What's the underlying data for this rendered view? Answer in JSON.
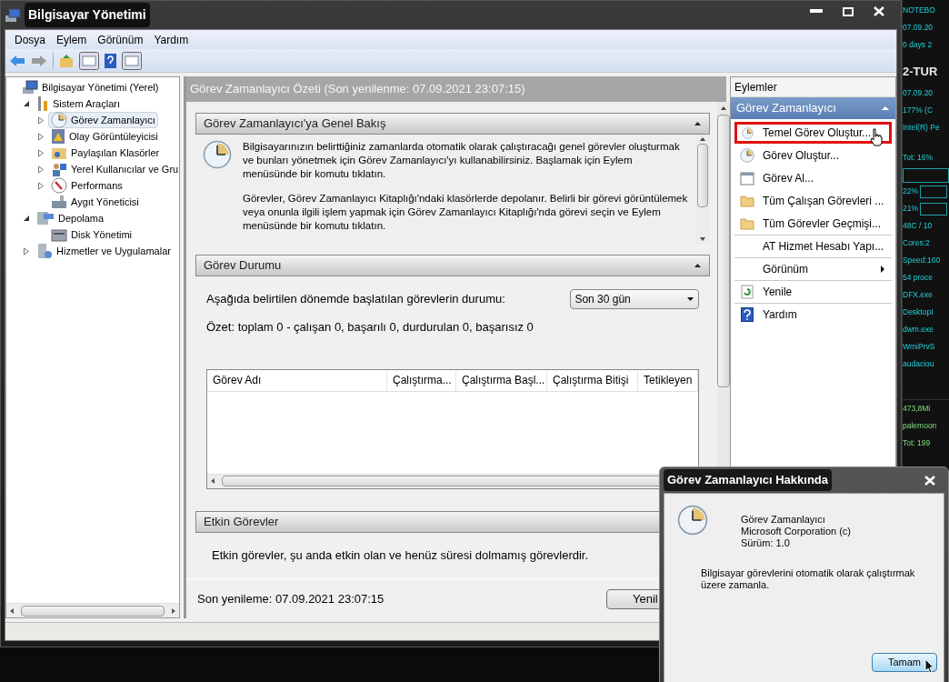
{
  "window": {
    "title": "Bilgisayar Yönetimi"
  },
  "menu": [
    "Dosya",
    "Eylem",
    "Görünüm",
    "Yardım"
  ],
  "tree": [
    {
      "label": "Bilgisayar Yönetimi (Yerel)",
      "kind": "computer",
      "selected": false,
      "children": [
        {
          "label": "Sistem Araçları",
          "kind": "tools",
          "expanded": true,
          "selected": false,
          "children": [
            {
              "label": "Görev Zamanlayıcı",
              "kind": "clock",
              "expanded": false,
              "selected": true
            },
            {
              "label": "Olay Görüntüleyicisi",
              "kind": "log",
              "expanded": false,
              "selected": false
            },
            {
              "label": "Paylaşılan Klasörler",
              "kind": "share",
              "expanded": false,
              "selected": false
            },
            {
              "label": "Yerel Kullanıcılar ve Gru",
              "kind": "users",
              "expanded": false,
              "selected": false
            },
            {
              "label": "Performans",
              "kind": "perf",
              "expanded": false,
              "selected": false
            },
            {
              "label": "Aygıt Yöneticisi",
              "kind": "device",
              "selected": false
            }
          ]
        },
        {
          "label": "Depolama",
          "kind": "storage",
          "expanded": true,
          "selected": false,
          "children": [
            {
              "label": "Disk Yönetimi",
              "kind": "disk",
              "selected": false
            }
          ]
        },
        {
          "label": "Hizmetler ve Uygulamalar",
          "kind": "services",
          "expanded": false,
          "selected": false
        }
      ]
    }
  ],
  "center": {
    "header": "Görev Zamanlayıcı Özeti (Son yenilenme: 07.09.2021 23:07:15)",
    "overview": {
      "title": "Görev Zamanlayıcı'ya Genel Bakış",
      "expanded": true,
      "paragraphs": [
        "Bilgisayarınızın belirttiğiniz zamanlarda otomatik olarak çalıştıracağı genel görevler oluşturmak ve bunları yönetmek için Görev Zamanlayıcı'yı kullanabilirsiniz. Başlamak için Eylem menüsünde bir komutu tıklatın.",
        "Görevler, Görev Zamanlayıcı Kitaplığı'ndaki klasörlerde depolanır. Belirli bir görevi görüntülemek veya onunla ilgili işlem yapmak için Görev Zamanlayıcı Kitaplığı'nda görevi seçin ve Eylem menüsünde bir komutu tıklatın."
      ]
    },
    "status": {
      "title": "Görev Durumu",
      "expanded": true,
      "label": "Aşağıda belirtilen dönemde başlatılan görevlerin durumu:",
      "period": "Son 30 gün",
      "summary": "Özet: toplam 0 - çalışan 0, başarılı 0, durdurulan 0, başarısız 0",
      "columns": [
        "Görev Adı",
        "Çalıştırma...",
        "Çalıştırma Başl...",
        "Çalıştırma Bitişi",
        "Tetikleyen"
      ]
    },
    "active": {
      "title": "Etkin Görevler",
      "text": "Etkin görevler, şu anda etkin olan ve henüz süresi dolmamış görevlerdir."
    },
    "footer": {
      "text": "Son yenileme: 07.09.2021 23:07:15",
      "button": "Yenil"
    }
  },
  "actions": {
    "title": "Eylemler",
    "group": {
      "label": "Görev Zamanlayıcı",
      "expanded": true
    },
    "items": [
      {
        "label": "Temel Görev Oluştur...",
        "kind": "basic",
        "highlighted": true,
        "separator": false
      },
      {
        "label": "Görev Oluştur...",
        "kind": "create",
        "highlighted": false,
        "separator": false
      },
      {
        "label": "Görev Al...",
        "kind": "import",
        "highlighted": false,
        "separator": false
      },
      {
        "label": "Tüm Çalışan Görevleri ...",
        "kind": "folder",
        "highlighted": false,
        "separator": false
      },
      {
        "label": "Tüm Görevler Geçmişi...",
        "kind": "folder",
        "highlighted": false,
        "separator": true
      },
      {
        "label": "AT Hizmet Hesabı Yapı...",
        "kind": "none",
        "highlighted": false,
        "separator": true
      },
      {
        "label": "Görünüm",
        "kind": "submenu",
        "highlighted": false,
        "separator": true
      },
      {
        "label": "Yenile",
        "kind": "refresh",
        "highlighted": false,
        "separator": true
      },
      {
        "label": "Yardım",
        "kind": "help",
        "highlighted": false,
        "separator": false
      }
    ]
  },
  "dialog": {
    "title": "Görev Zamanlayıcı Hakkında",
    "product": [
      "Görev Zamanlayıcı",
      "Microsoft Corporation (c)",
      "Sürüm: 1.0"
    ],
    "description": "Bilgisayar görevlerini otomatik olarak çalıştırmak üzere zamanla.",
    "button": "Tamam"
  },
  "gadget": {
    "system": [
      {
        "text": "NOTEBO",
        "kind": "text"
      },
      {
        "text": "07.09.20",
        "kind": "text"
      },
      {
        "text": "0 days 2",
        "kind": "text"
      },
      {
        "text": "2-TUR",
        "kind": "title"
      },
      {
        "text": "07.09.20",
        "kind": "text"
      },
      {
        "text": "177% (C",
        "kind": "text"
      },
      {
        "text": "Intel(R) Pe",
        "kind": "text"
      },
      {
        "text": "Tot: 16%",
        "kind": "graph"
      },
      {
        "text": "22%",
        "kind": "meter"
      },
      {
        "text": "21%",
        "kind": "meter"
      },
      {
        "text": "48C / 10",
        "kind": "text"
      },
      {
        "text": "Cores:2",
        "kind": "text"
      },
      {
        "text": "Speed:160",
        "kind": "text"
      },
      {
        "text": "54 proce",
        "kind": "text"
      },
      {
        "text": "DFX.exe",
        "kind": "text"
      },
      {
        "text": "DesktopI",
        "kind": "text"
      },
      {
        "text": "dwm.exe",
        "kind": "text"
      },
      {
        "text": "WmiPrvS",
        "kind": "text"
      },
      {
        "text": "audaciou",
        "kind": "text"
      }
    ],
    "memory": [
      "473,8Mi",
      "palemoon",
      "Tot: 199"
    ]
  }
}
